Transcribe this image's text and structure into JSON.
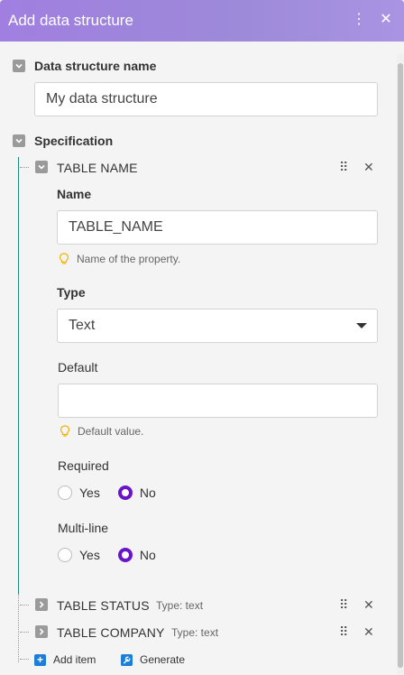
{
  "header": {
    "title": "Add data structure"
  },
  "structure": {
    "name_label": "Data structure name",
    "name_value": "My data structure",
    "spec_label": "Specification"
  },
  "item": {
    "title": "TABLE NAME",
    "name_label": "Name",
    "name_value": "TABLE_NAME",
    "name_hint": "Name of the property.",
    "type_label": "Type",
    "type_value": "Text",
    "default_label": "Default",
    "default_value": "",
    "default_hint": "Default value.",
    "required_label": "Required",
    "multiline_label": "Multi-line",
    "yes_label": "Yes",
    "no_label": "No"
  },
  "collapsed_items": [
    {
      "title": "TABLE STATUS",
      "type": "Type: text"
    },
    {
      "title": "TABLE COMPANY",
      "type": "Type: text"
    }
  ],
  "footer": {
    "add_item": "Add item",
    "generate": "Generate"
  },
  "colors": {
    "accent": "#6a14c9",
    "tree": "#1a8a7a",
    "header": "#a07fe0"
  }
}
